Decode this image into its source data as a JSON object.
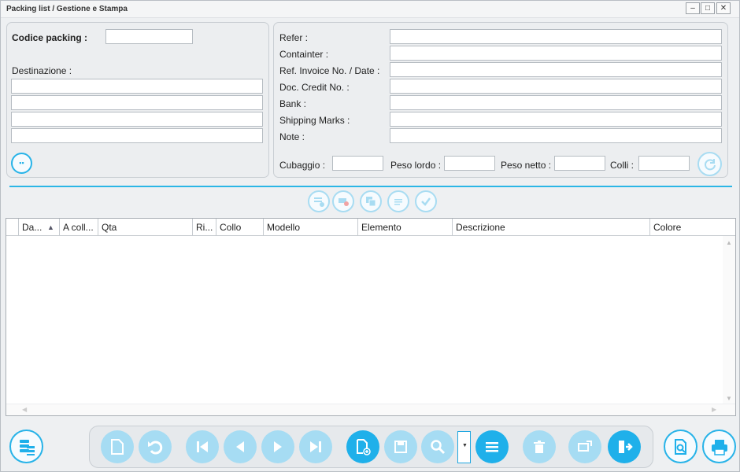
{
  "window": {
    "title": "Packing list / Gestione e Stampa",
    "controls": [
      "minimize",
      "maximize",
      "close"
    ]
  },
  "header_left": {
    "codice_packing_label": "Codice packing :",
    "codice_packing_value": "",
    "destinazione_label": "Destinazione :",
    "destinazione_lines": [
      "",
      "",
      "",
      ""
    ]
  },
  "header_right": {
    "fields": [
      {
        "label": "Refer :",
        "value": ""
      },
      {
        "label": "Containter  :",
        "value": ""
      },
      {
        "label": "Ref. Invoice No. / Date :",
        "value": ""
      },
      {
        "label": "Doc. Credit No. :",
        "value": ""
      },
      {
        "label": "Bank :",
        "value": ""
      },
      {
        "label": "Shipping Marks :",
        "value": ""
      },
      {
        "label": "Note :",
        "value": ""
      }
    ],
    "cubaggio_label": "Cubaggio :",
    "peso_lordo_label": "Peso lordo :",
    "peso_netto_label": "Peso netto :",
    "colli_label": "Colli :"
  },
  "grid": {
    "columns": [
      "Da...",
      "A coll...",
      "Qta",
      "Ri...",
      "Collo",
      "Modello",
      "Elemento",
      "Descrizione",
      "Colore"
    ],
    "sort_column": "Da...",
    "sort_direction": "ascending",
    "rows": []
  },
  "row_actions": [
    "add-row-icon",
    "remove-row-icon",
    "copy-row-icon",
    "edit-row-icon",
    "confirm-icon"
  ],
  "toolbar": {
    "buttons": [
      "new-document-icon",
      "undo-icon",
      "first-record-icon",
      "previous-record-icon",
      "next-record-icon",
      "last-record-icon",
      "new-record-icon",
      "save-icon",
      "search-icon",
      "list-icon",
      "delete-icon",
      "export-icon",
      "exit-icon"
    ]
  },
  "colors": {
    "accent": "#1fb0ea",
    "accent_faded": "#a6dcf3",
    "divider": "#2bb6e6"
  }
}
